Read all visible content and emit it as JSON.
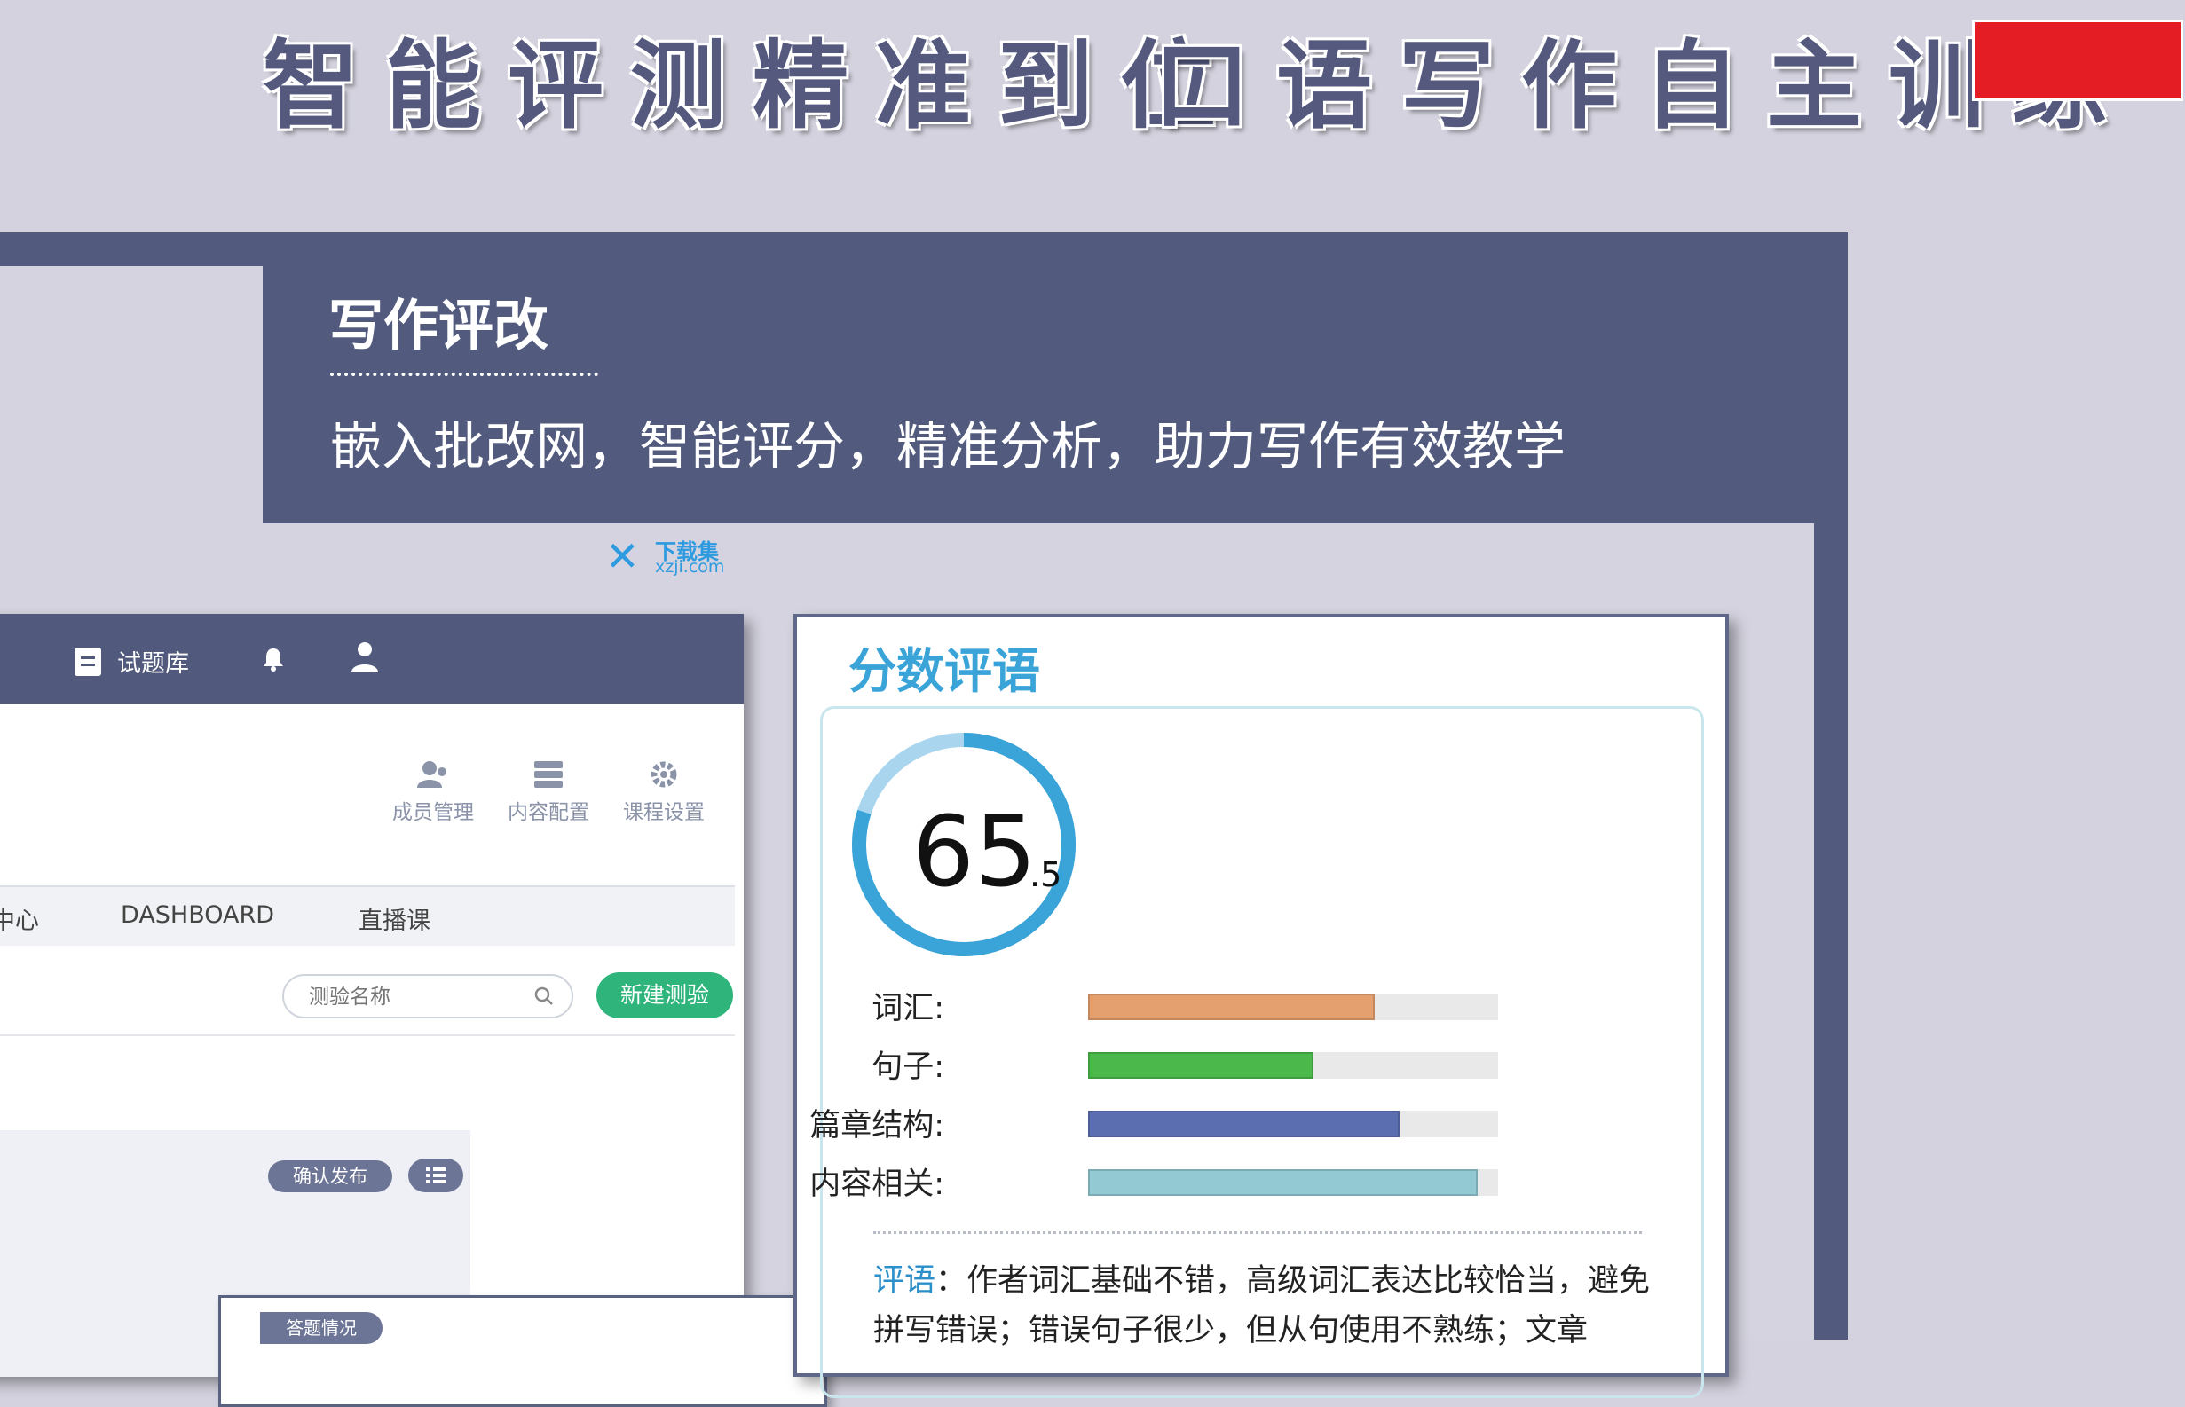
{
  "headline": {
    "left": "智能评测精准到位",
    "right": "口语写作自主训练"
  },
  "section": {
    "title": "写作评改",
    "description": "嵌入批改网，智能评分，精准分析，助力写作有效教学"
  },
  "watermark": {
    "top": "下载集",
    "bottom": "xzji.com"
  },
  "app": {
    "topnav": {
      "question_bank": "试题库"
    },
    "tools": {
      "members": "成员管理",
      "content": "内容配置",
      "course": "课程设置"
    },
    "tabs": [
      "中心",
      "DASHBOARD",
      "直播课"
    ],
    "search": {
      "placeholder": "测验名称"
    },
    "new_test": "新建测验",
    "confirm_publish": "确认发布",
    "sub_tab": "答题情况"
  },
  "score_card": {
    "title": "分数评语",
    "score_int": "65",
    "score_dec": ".5",
    "score_fraction": 0.8,
    "metrics": [
      {
        "label": "词汇:",
        "fraction": 0.7,
        "color": "#e5a070"
      },
      {
        "label": "句子:",
        "fraction": 0.55,
        "color": "#4bb84b"
      },
      {
        "label": "篇章结构:",
        "fraction": 0.76,
        "color": "#5b6fb0"
      },
      {
        "label": "内容相关:",
        "fraction": 0.95,
        "color": "#92c9d3"
      }
    ],
    "comment_key": "评语",
    "comment_text": "：作者词汇基础不错，高级词汇表达比较恰当，避免拼写错误；错误句子很少，但从句使用不熟练；文章"
  },
  "colors": {
    "brand_dark": "#525b7e",
    "accent_red": "#e41d25",
    "accent_blue": "#3aa3d8",
    "accent_green": "#2fb57c"
  }
}
